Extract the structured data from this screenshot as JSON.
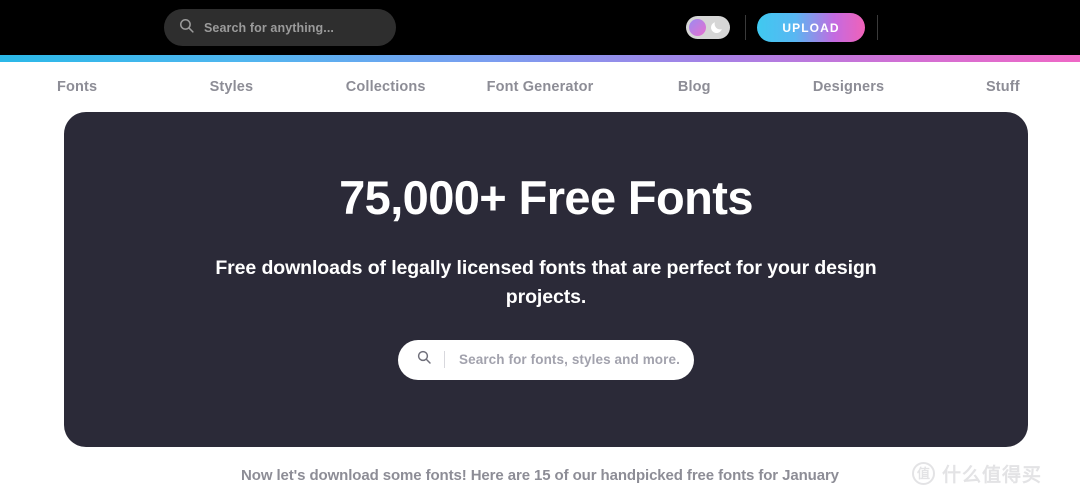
{
  "header": {
    "search": {
      "placeholder": "Search for anything...",
      "icon": "search-icon"
    },
    "theme_toggle": {
      "icon": "moon-icon",
      "state": "light"
    },
    "upload_label": "UPLOAD",
    "accent_gradient_start": "#2bb8e8",
    "accent_gradient_end": "#ef68c6"
  },
  "nav": {
    "items": [
      {
        "label": "Fonts"
      },
      {
        "label": "Styles"
      },
      {
        "label": "Collections"
      },
      {
        "label": "Font Generator"
      },
      {
        "label": "Blog"
      },
      {
        "label": "Designers"
      },
      {
        "label": "Stuff"
      }
    ]
  },
  "hero": {
    "background_color": "#2b2a38",
    "title": "75,000+ Free Fonts",
    "subtitle": "Free downloads of legally licensed fonts that are perfect for your design projects.",
    "search": {
      "placeholder": "Search for fonts, styles and more.",
      "icon": "search-icon"
    }
  },
  "footer": {
    "note": "Now let's download some fonts! Here are 15 of our handpicked free fonts for January"
  },
  "watermark": {
    "mark": "值",
    "text": "什么值得买"
  }
}
